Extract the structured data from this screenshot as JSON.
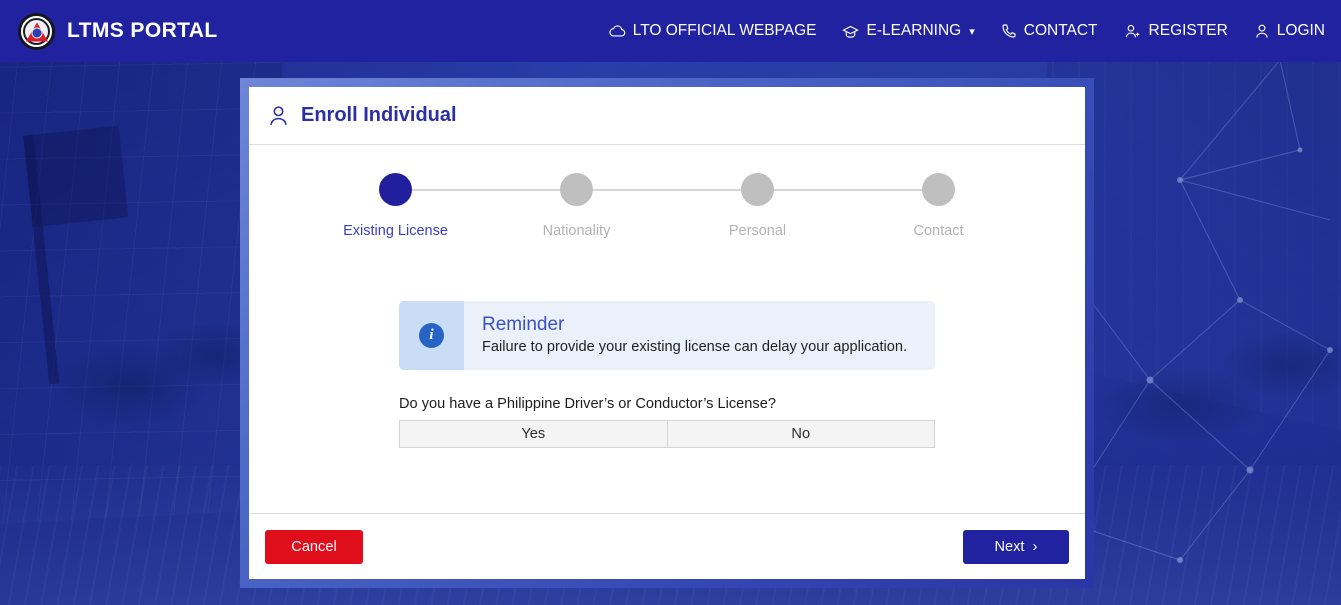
{
  "header": {
    "brand_title": "LTMS PORTAL",
    "logo_icon": "lto-seal-logo",
    "nav": [
      {
        "label": "LTO OFFICIAL WEBPAGE",
        "icon": "cloud-icon",
        "caret": ""
      },
      {
        "label": "E-LEARNING",
        "icon": "graduation-cap-icon",
        "caret": "▾"
      },
      {
        "label": "CONTACT",
        "icon": "phone-icon",
        "caret": ""
      },
      {
        "label": "REGISTER",
        "icon": "user-plus-icon",
        "caret": ""
      },
      {
        "label": "LOGIN",
        "icon": "user-icon",
        "caret": ""
      }
    ]
  },
  "card": {
    "title": "Enroll Individual",
    "title_icon": "user-icon",
    "stepper": [
      {
        "label": "Existing License",
        "active": true
      },
      {
        "label": "Nationality",
        "active": false
      },
      {
        "label": "Personal",
        "active": false
      },
      {
        "label": "Contact",
        "active": false
      }
    ],
    "alert": {
      "icon": "info-circle-icon",
      "icon_glyph": "i",
      "title": "Reminder",
      "text": "Failure to provide your existing license can delay your application."
    },
    "question": {
      "text": "Do you have a Philippine Driver’s or Conductor’s License?",
      "options": [
        {
          "label": "Yes"
        },
        {
          "label": "No"
        }
      ]
    },
    "footer": {
      "cancel_label": "Cancel",
      "next_label": "Next",
      "next_icon": "chevron-right-icon",
      "next_chevron": "›"
    }
  },
  "colors": {
    "header_blue": "#2022a0",
    "active_step": "#221f9e",
    "inactive_step": "#bfbfbf",
    "alert_bg": "#eaf1fb",
    "alert_icon_bg": "#c9ddf6",
    "info_blue": "#2563c4",
    "cancel_red": "#e00d1a",
    "title_blue": "#2a2fa3"
  }
}
